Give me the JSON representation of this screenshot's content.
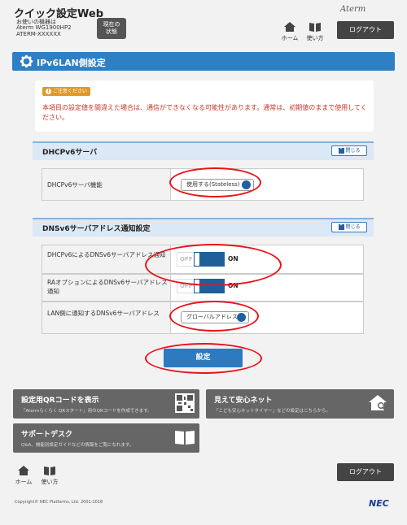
{
  "header": {
    "app_title": "クイック設定Web",
    "device_caption": "お使いの機器は",
    "device_model": "Aterm WG1900HP2",
    "device_id": "ATERM-XXXXXX",
    "status_button": "現在の\n状態",
    "home_label": "ホーム",
    "guide_label": "使い方",
    "brand": "Aterm",
    "logout_label": "ログアウト"
  },
  "page": {
    "title": "IPv6LAN側設定"
  },
  "warning": {
    "badge": "ご注意ください",
    "text": "本項目の設定値を間違えた場合は、通信ができなくなる可能性があります。通常は、初期値のままで使用してください。"
  },
  "dhcp_section": {
    "title": "DHCPv6サーバ",
    "close_label": "閉じる",
    "row_label": "DHCPv6サーバ機能",
    "select_value": "使用する(Stateless)"
  },
  "dns_section": {
    "title": "DNSv6サーバアドレス通知設定",
    "close_label": "閉じる",
    "rows": [
      {
        "label": "DHCPv6によるDNSv6サーバアドレス通知",
        "off": "OFF",
        "on": "ON",
        "state": "ON"
      },
      {
        "label": "RAオプションによるDNSv6サーバアドレス通知",
        "off": "OFF",
        "on": "ON",
        "state": "ON"
      }
    ],
    "lan_row_label": "LAN側に通知するDNSv6サーバアドレス",
    "lan_select_value": "グローバルアドレス"
  },
  "apply_label": "設定",
  "tiles": {
    "qr_title": "設定用QRコードを表示",
    "qr_sub": "「Atermらくらく QRスタート」用のQRコードを作成できます。",
    "net_title": "見えて安心ネット",
    "net_sub": "「こども安心ネットタイマー」などの設定はこちらから。",
    "support_title": "サポートデスク",
    "support_sub": "Q&A、機能別設定ガイドなどの情報をご覧になれます。"
  },
  "footer": {
    "home_label": "ホーム",
    "guide_label": "使い方",
    "logout_label": "ログアウト",
    "copyright": "Copyright© NEC Platforms, Ltd. 2001-2018",
    "brand": "NEC"
  },
  "colors": {
    "accent": "#2e7fc4",
    "warning_text": "#c8362a",
    "highlight": "#e8131a"
  }
}
